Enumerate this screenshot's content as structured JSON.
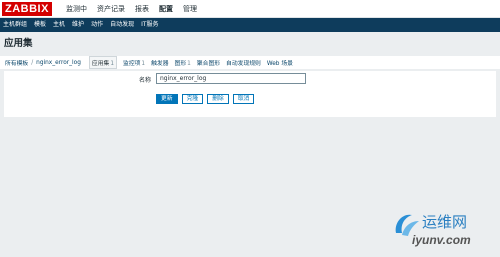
{
  "header": {
    "logo": "ZABBIX",
    "nav": [
      {
        "label": "监测中",
        "active": false
      },
      {
        "label": "资产记录",
        "active": false
      },
      {
        "label": "报表",
        "active": false
      },
      {
        "label": "配置",
        "active": true
      },
      {
        "label": "管理",
        "active": false
      }
    ]
  },
  "subnav": [
    {
      "label": "主机群组"
    },
    {
      "label": "模板"
    },
    {
      "label": "主机"
    },
    {
      "label": "维护"
    },
    {
      "label": "动作"
    },
    {
      "label": "自动发现"
    },
    {
      "label": "IT服务"
    }
  ],
  "page": {
    "title": "应用集"
  },
  "breadcrumb": {
    "root": "所有模板",
    "separator": "/",
    "template": "nginx_error_log"
  },
  "tabs": [
    {
      "label": "应用集",
      "count": "1",
      "selected": true
    },
    {
      "label": "监控项",
      "count": "1",
      "selected": false
    },
    {
      "label": "触发器",
      "count": "",
      "selected": false
    },
    {
      "label": "图形",
      "count": "1",
      "selected": false
    },
    {
      "label": "聚合图形",
      "count": "",
      "selected": false
    },
    {
      "label": "自动发现规则",
      "count": "",
      "selected": false
    },
    {
      "label": "Web 场景",
      "count": "",
      "selected": false
    }
  ],
  "form": {
    "name_label": "名称",
    "name_value": "nginx_error_log",
    "buttons": {
      "update": "更新",
      "clone": "克隆",
      "delete": "删除",
      "cancel": "取消"
    }
  },
  "watermark": {
    "top": "运维网",
    "bottom": "iyunv.com"
  },
  "colors": {
    "logo_red": "#d40000",
    "subnav_bg": "#0e3c5c",
    "accent_blue": "#0275b8",
    "page_bg": "#ebeef0"
  }
}
